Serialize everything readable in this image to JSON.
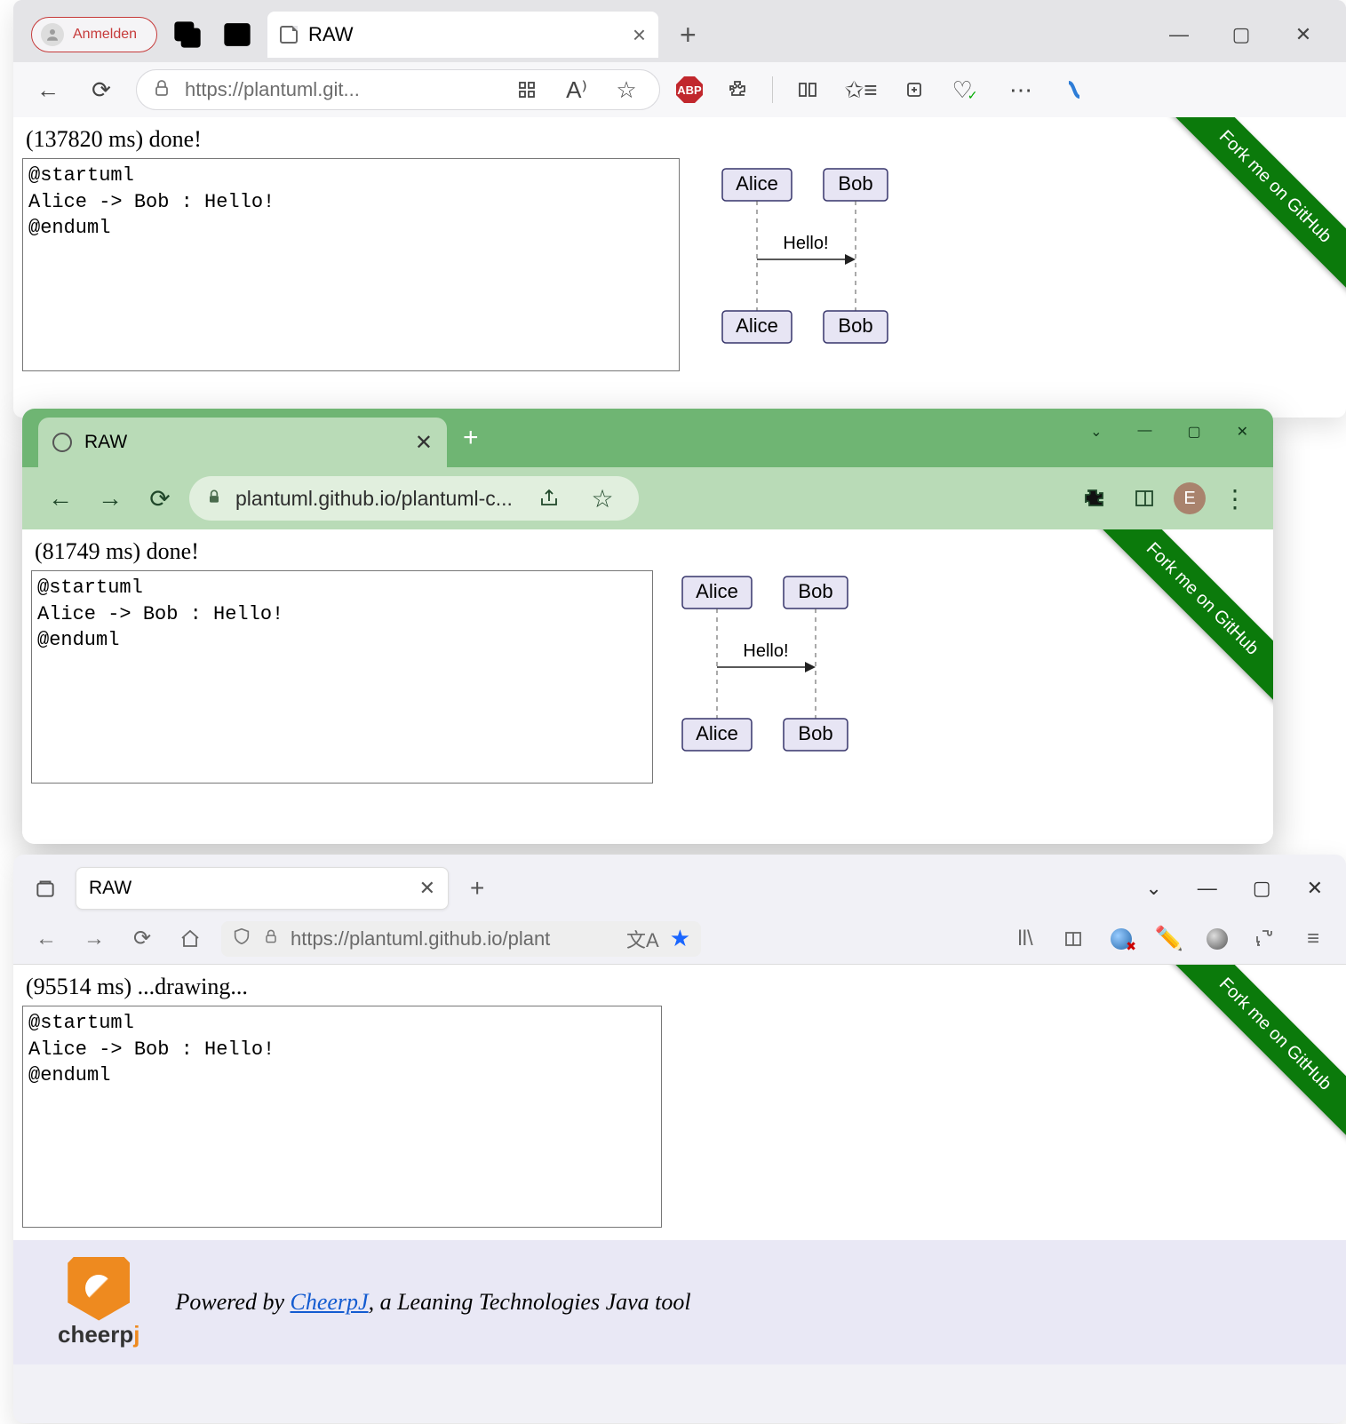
{
  "win1": {
    "login": "Anmelden",
    "tab_title": "RAW",
    "url": "https://plantuml.git...",
    "status": "(137820 ms) done!",
    "code": "@startuml\nAlice -> Bob : Hello!\n@enduml",
    "abp": "ABP"
  },
  "win2": {
    "tab_title": "RAW",
    "url": "plantuml.github.io/plantuml-c...",
    "avatar_letter": "E",
    "status": "(81749 ms) done!",
    "code": "@startuml\nAlice -> Bob : Hello!\n@enduml"
  },
  "win3": {
    "tab_title": "RAW",
    "url": "https://plantuml.github.io/plant",
    "status": "(95514 ms) ...drawing...",
    "code": "@startuml\nAlice -> Bob : Hello!\n@enduml",
    "footer_prefix": "Powered by ",
    "footer_link": "CheerpJ",
    "footer_suffix": ", a Leaning Technologies Java tool",
    "brand": "cheerp",
    "brand_suffix": "j"
  },
  "diagram": {
    "a": "Alice",
    "b": "Bob",
    "msg": "Hello!"
  },
  "fork": "Fork me on GitHub"
}
